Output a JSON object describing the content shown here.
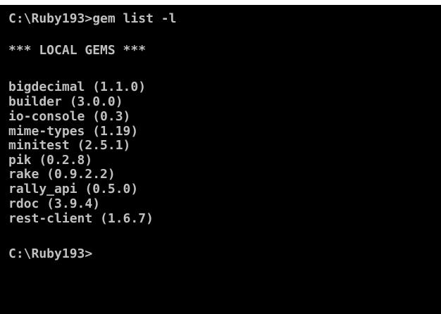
{
  "console": {
    "command_line": "C:\\Ruby193>gem list -l",
    "header": "*** LOCAL GEMS ***",
    "gems": [
      "bigdecimal (1.1.0)",
      "builder (3.0.0)",
      "io-console (0.3)",
      "mime-types (1.19)",
      "minitest (2.5.1)",
      "pik (0.2.8)",
      "rake (0.9.2.2)",
      "rally_api (0.5.0)",
      "rdoc (3.9.4)",
      "rest-client (1.6.7)"
    ],
    "prompt": "C:\\Ruby193>"
  },
  "colors": {
    "background": "#000000",
    "text": "#c0c0c0"
  }
}
